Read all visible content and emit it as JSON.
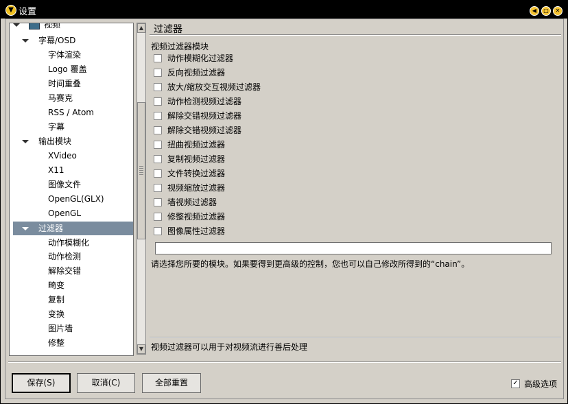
{
  "window": {
    "title": "设置"
  },
  "tree": {
    "items": [
      {
        "label": "视频",
        "level": 1,
        "expanded": true
      },
      {
        "label": "字幕/OSD",
        "level": 2,
        "expanded": true
      },
      {
        "label": "字体渲染",
        "level": 3
      },
      {
        "label": "Logo 覆盖",
        "level": 3
      },
      {
        "label": "时间重叠",
        "level": 3
      },
      {
        "label": "马赛克",
        "level": 3
      },
      {
        "label": "RSS / Atom",
        "level": 3
      },
      {
        "label": "字幕",
        "level": 3
      },
      {
        "label": "输出模块",
        "level": 2,
        "expanded": true
      },
      {
        "label": "XVideo",
        "level": 3
      },
      {
        "label": "X11",
        "level": 3
      },
      {
        "label": "图像文件",
        "level": 3
      },
      {
        "label": "OpenGL(GLX)",
        "level": 3
      },
      {
        "label": "OpenGL",
        "level": 3
      },
      {
        "label": "过滤器",
        "level": 2,
        "expanded": true,
        "selected": true
      },
      {
        "label": "动作模糊化",
        "level": 3
      },
      {
        "label": "动作检测",
        "level": 3
      },
      {
        "label": "解除交错",
        "level": 3
      },
      {
        "label": "畸变",
        "level": 3
      },
      {
        "label": "复制",
        "level": 3
      },
      {
        "label": "变换",
        "level": 3
      },
      {
        "label": "图片墙",
        "level": 3
      },
      {
        "label": "修整",
        "level": 3
      }
    ]
  },
  "pane": {
    "title": "过滤器",
    "section_label": "视频过滤器模块",
    "filters": [
      {
        "label": "动作模糊化过滤器",
        "checked": false
      },
      {
        "label": "反向视频过滤器",
        "checked": false
      },
      {
        "label": "放大/缩放交互视频过滤器",
        "checked": false
      },
      {
        "label": "动作检测视频过滤器",
        "checked": false
      },
      {
        "label": "解除交错视频过滤器",
        "checked": false
      },
      {
        "label": "解除交错视频过滤器",
        "checked": false
      },
      {
        "label": "扭曲视频过滤器",
        "checked": false
      },
      {
        "label": "复制视频过滤器",
        "checked": false
      },
      {
        "label": "文件转换过滤器",
        "checked": false
      },
      {
        "label": "视频缩放过滤器",
        "checked": false
      },
      {
        "label": "墙视频过滤器",
        "checked": false
      },
      {
        "label": "修整视频过滤器",
        "checked": false
      },
      {
        "label": "图像属性过滤器",
        "checked": false
      }
    ],
    "chain_value": "",
    "help_text": "请选择您所要的模块。如果要得到更高级的控制，您也可以自己修改所得到的“chain”。",
    "description": "视频过滤器可以用于对视频流进行善后处理"
  },
  "footer": {
    "save_label": "保存(S)",
    "cancel_label": "取消(C)",
    "reset_label": "全部重置",
    "advanced_label": "高级选项",
    "advanced_checked": true
  }
}
